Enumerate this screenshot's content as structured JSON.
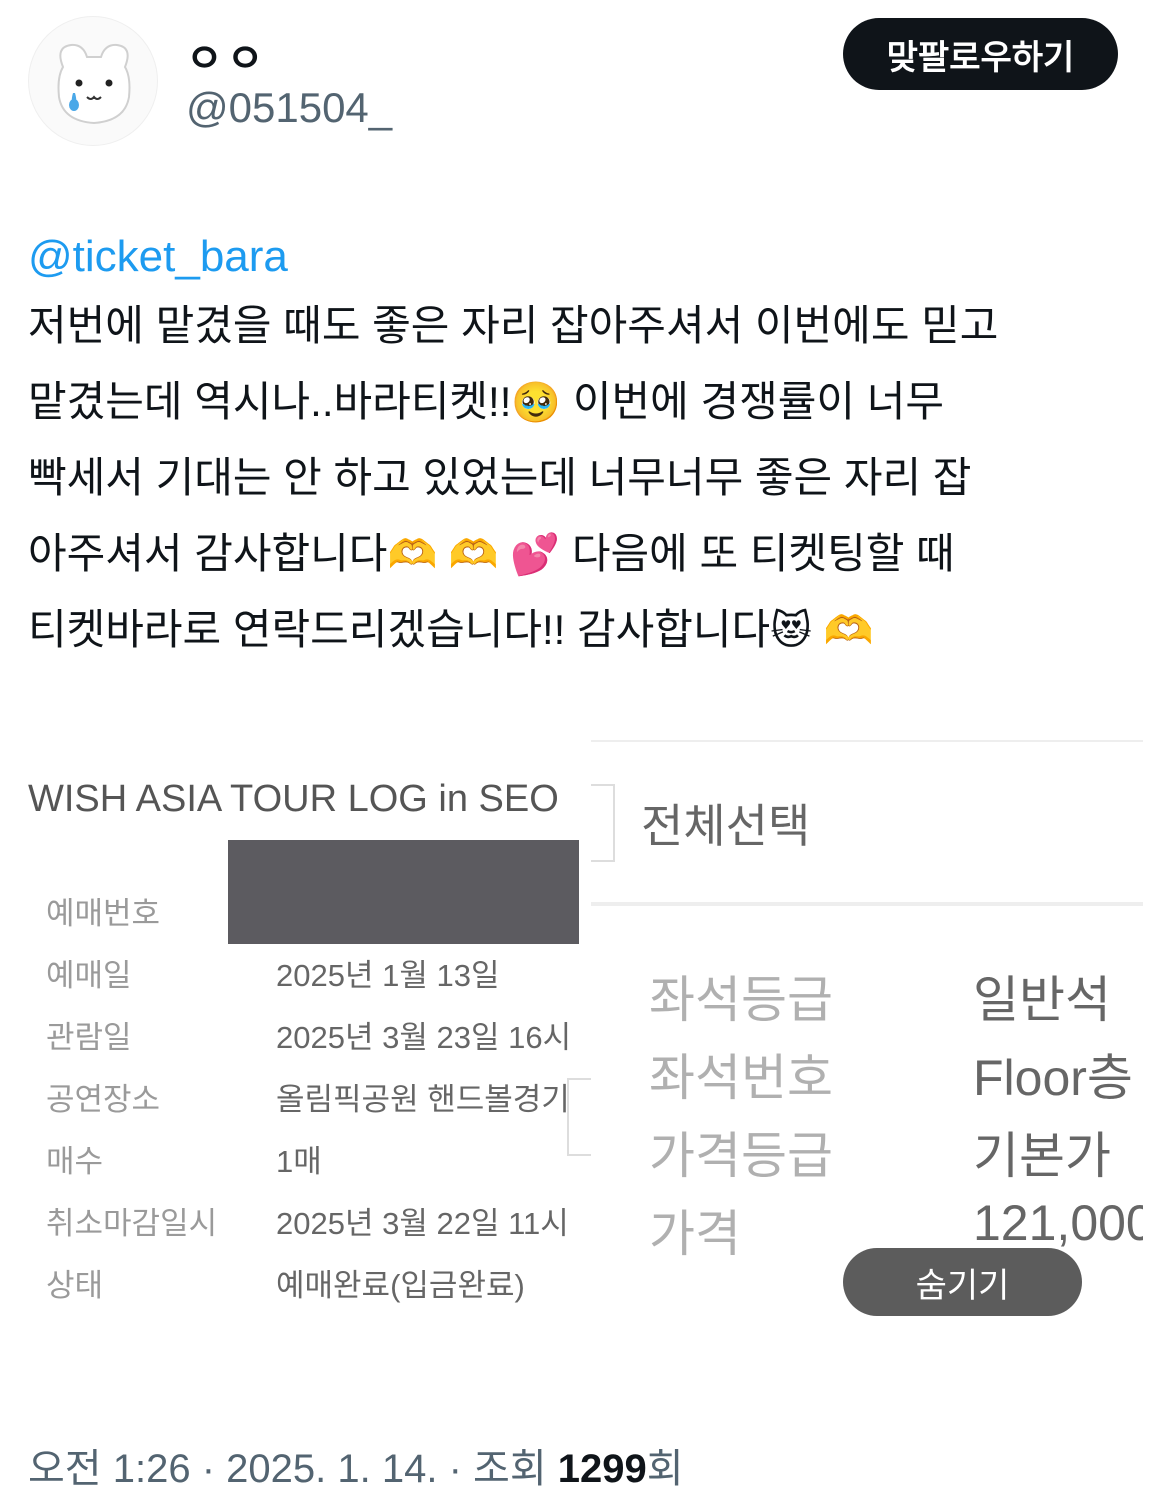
{
  "author": {
    "display_name": "ㅇㅇ",
    "handle": "@051504_"
  },
  "follow_button_label": "맞팔로우하기",
  "post": {
    "mention": "@ticket_bara",
    "lines": [
      "저번에 맡겼을 때도 좋은 자리 잡아주셔서 이번에도 믿고",
      "맡겼는데 역시나..바라티켓!!",
      "이번에 경쟁률이 너무",
      "빡세서 기대는 안 하고 있었는데 너무너무 좋은 자리 잡",
      "아주셔서 감사합니다",
      "다음에 또 티켓팅할 때",
      "티켓바라로 연락드리겠습니다!! 감사합니다"
    ],
    "emojis": {
      "pleading": "🥹",
      "heart_hands_1": "🫶",
      "heart_hands_2": "🫶",
      "two_hearts": "💕",
      "heart_eyes_cat": "😻",
      "heart_hands_3": "🫶"
    }
  },
  "attachment": {
    "event_title": "WISH ASIA TOUR LOG in SEO",
    "booking_info": [
      {
        "label": "예매번호",
        "value": ""
      },
      {
        "label": "예매일",
        "value": "2025년 1월 13일"
      },
      {
        "label": "관람일",
        "value": "2025년 3월 23일 16시"
      },
      {
        "label": "공연장소",
        "value": "올림픽공원 핸드볼경기"
      },
      {
        "label": "매수",
        "value": "1매"
      },
      {
        "label": "취소마감일시",
        "value": "2025년 3월 22일 11시"
      },
      {
        "label": "상태",
        "value": "예매완료(입금완료)"
      }
    ],
    "select_all_label": "전체선택",
    "seat_info": [
      {
        "label": "좌석등급",
        "value": "일반석"
      },
      {
        "label": "좌석번호",
        "value": "Floor층"
      },
      {
        "label": "가격등급",
        "value": "기본가"
      },
      {
        "label": "가격",
        "value": "121,000"
      }
    ]
  },
  "hide_button_label": "숨기기",
  "meta": {
    "time": "오전 1:26",
    "date": "2025. 1. 14.",
    "views_prefix": "조회",
    "views_count": "1299",
    "views_suffix": "회"
  }
}
